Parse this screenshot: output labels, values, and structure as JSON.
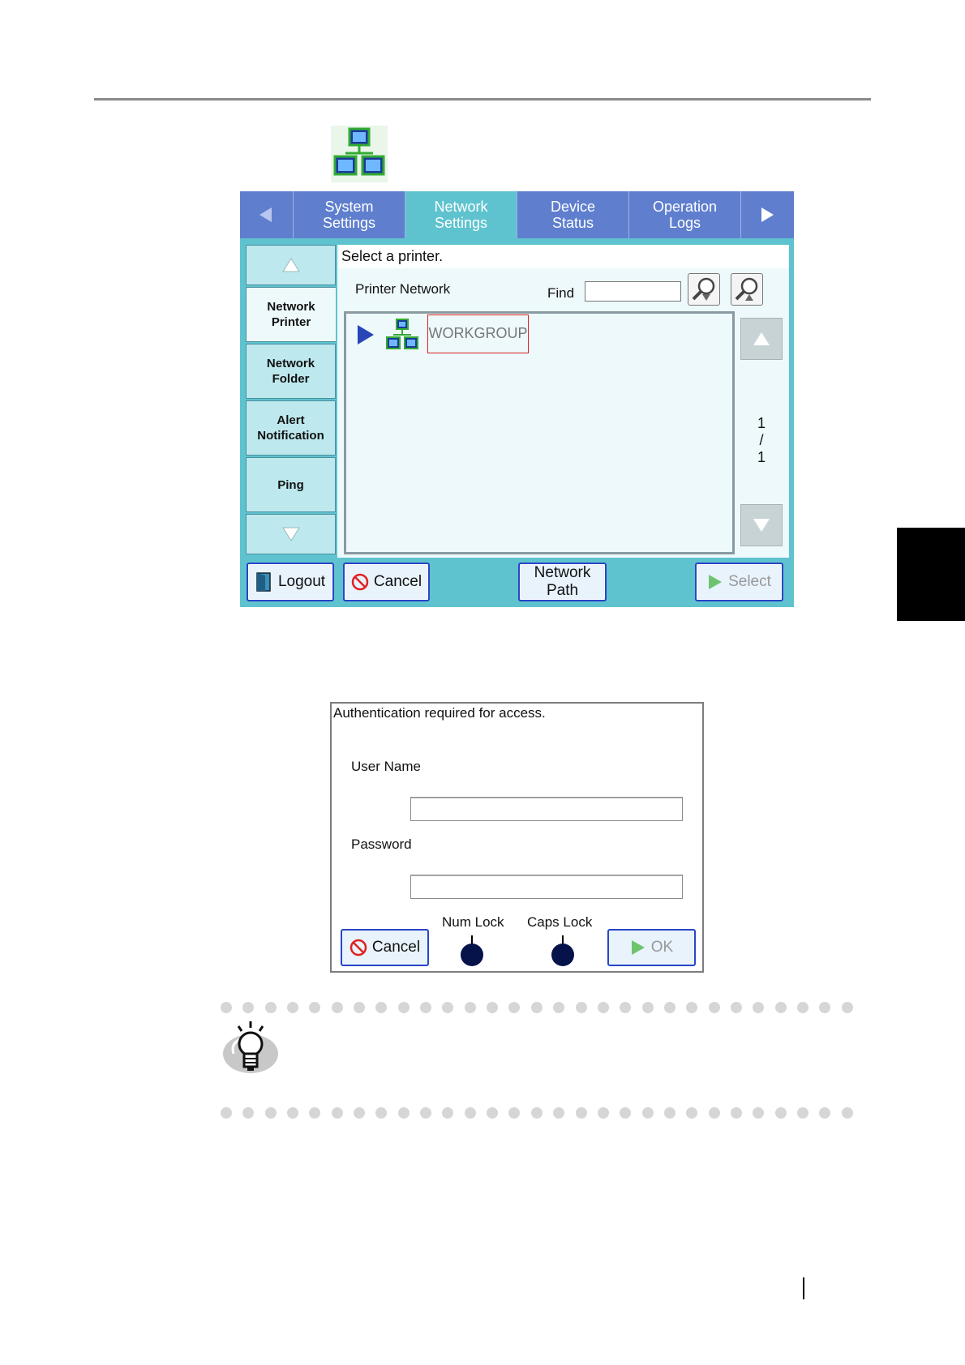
{
  "screen1": {
    "tabs": [
      {
        "label": "System\nSettings"
      },
      {
        "label": "Network\nSettings"
      },
      {
        "label": "Device\nStatus"
      },
      {
        "label": "Operation\nLogs"
      }
    ],
    "sidebar": {
      "items": [
        {
          "label": "Network\nPrinter"
        },
        {
          "label": "Network\nFolder"
        },
        {
          "label": "Alert\nNotification"
        },
        {
          "label": "Ping"
        }
      ]
    },
    "instruction": "Select a printer.",
    "printer_network_label": "Printer Network",
    "find_label": "Find",
    "find_value": "",
    "tree": {
      "workgroup": "WORKGROUP"
    },
    "pager": {
      "current": "1",
      "sep": "/",
      "total": "1"
    },
    "buttons": {
      "logout": "Logout",
      "cancel": "Cancel",
      "network_path": "Network\nPath",
      "select": "Select"
    }
  },
  "screen2": {
    "title": "Authentication required for access.",
    "user_name_label": "User Name",
    "user_name_value": "",
    "password_label": "Password",
    "password_value": "",
    "num_lock": "Num Lock",
    "caps_lock": "Caps Lock",
    "cancel": "Cancel",
    "ok": "OK"
  },
  "colors": {
    "tab_bar": "#5f7fce",
    "panel": "#5ec3ce",
    "button_border": "#2a44c8",
    "highlight_border": "#e02020"
  }
}
